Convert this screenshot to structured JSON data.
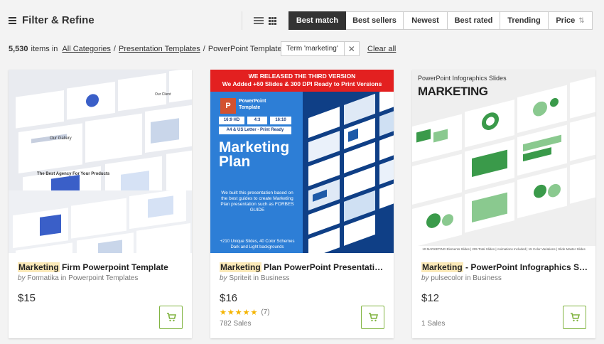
{
  "toolbar": {
    "filter_label": "Filter & Refine",
    "sort_options": [
      {
        "label": "Best match",
        "active": true
      },
      {
        "label": "Best sellers",
        "active": false
      },
      {
        "label": "Newest",
        "active": false
      },
      {
        "label": "Best rated",
        "active": false
      },
      {
        "label": "Trending",
        "active": false
      },
      {
        "label": "Price",
        "active": false
      }
    ]
  },
  "results": {
    "count": "5,530",
    "items_in": "items in",
    "breadcrumbs": [
      "All Categories",
      "Presentation Templates",
      "PowerPoint Templates"
    ],
    "separator": "/",
    "term_chip": "Term 'marketing'",
    "clear_all": "Clear all"
  },
  "cards": [
    {
      "highlight": "Marketing",
      "title_rest": " Firm Powerpoint Template",
      "by": "by",
      "author": "Formatika",
      "in": "in",
      "category": "Powerpoint Templates",
      "price": "$15",
      "thumb_text": {
        "gallery": "Our Gallery",
        "headline": "The Best Agency For Your Products",
        "other": "Our Client"
      }
    },
    {
      "highlight": "Marketing",
      "title_rest": " Plan PowerPoint Presentation Template",
      "by": "by",
      "author": "Spriteit",
      "in": "in",
      "category": "Business",
      "price": "$16",
      "stars": "★★★★★",
      "rating_count": "(7)",
      "sales": "782 Sales",
      "thumb_text": {
        "banner_1": "WE RELEASED THE THIRD VERSION",
        "banner_2": "We Added +60 Slides & 300 DPI Ready to Print Versions",
        "pp": "P",
        "pp_label": "PowerPoint Template",
        "tag_1": "16:9 HD",
        "tag_2": "4:3",
        "tag_3": "16:10",
        "tag_4": "A4 & US Letter - Print Ready",
        "big_title": "Marketing Plan",
        "desc": "We built this presentation based on the best guides to create Marketing Plan presentation such as FORBES GUIDE",
        "foot": "+210 Unique Slides, 40 Color Schemes Dark and Light backgrounds"
      }
    },
    {
      "highlight": "Marketing",
      "title_rest": " - PowerPoint Infographics Slides",
      "by": "by",
      "author": "pulsecolor",
      "in": "in",
      "category": "Business",
      "price": "$12",
      "sales": "1 Sales",
      "thumb_text": {
        "subtitle": "PowerPoint Infographics Slides",
        "title": "MARKETING",
        "strip": "10 MARKETING Elements Slides | 205 Total Slides | Animations Included | 15 Color Variations | Slide Master Slides"
      }
    }
  ],
  "colors": {
    "accent_active": "#333333",
    "cart_green": "#81b441",
    "highlight": "#fbe9b8",
    "star": "#f4b400"
  },
  "icons": [
    "filter-icon",
    "list-view-icon",
    "grid-view-icon",
    "sort-arrows-icon",
    "close-icon",
    "cart-icon",
    "star-icon"
  ]
}
